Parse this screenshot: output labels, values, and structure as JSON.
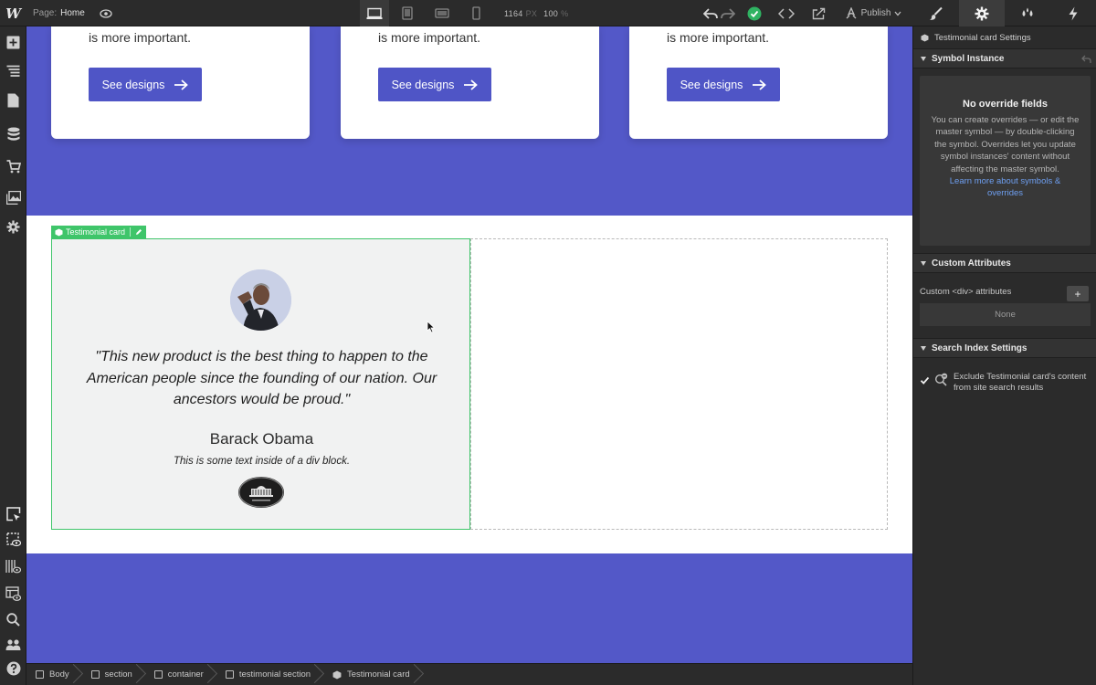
{
  "topbar": {
    "logo": "W",
    "page_label": "Page:",
    "page_name": "Home",
    "width_value": "1164",
    "width_unit": "PX",
    "zoom_value": "100",
    "zoom_unit": "%",
    "publish_label": "Publish"
  },
  "canvas": {
    "cards": [
      {
        "text": "is more important.",
        "button": "See designs"
      },
      {
        "text": "is more important.",
        "button": "See designs"
      },
      {
        "text": "is more important.",
        "button": "See designs"
      }
    ],
    "selected_label": "Testimonial card",
    "testimonial": {
      "quote": "\"This new product is the best thing to happen to the American people since the founding of our nation. Our ancestors would be proud.\"",
      "name": "Barack Obama",
      "subtext": "This is some text inside of a div block."
    },
    "colors": {
      "section_bg": "#5358c8",
      "button_bg": "#4f55c6",
      "selection": "#3fc56a"
    }
  },
  "breadcrumbs": [
    {
      "label": "Body"
    },
    {
      "label": "section"
    },
    {
      "label": "container"
    },
    {
      "label": "testimonial section"
    },
    {
      "label": "Testimonial card"
    }
  ],
  "panel": {
    "title": "Testimonial card Settings",
    "symbol_instance": {
      "heading": "Symbol Instance",
      "title": "No override fields",
      "body": "You can create overrides — or edit the master symbol — by double-clicking the symbol. Overrides let you update symbol instances' content without affecting the master symbol.",
      "link": "Learn more about symbols & overrides"
    },
    "custom_attributes": {
      "heading": "Custom Attributes",
      "label": "Custom <div> attributes",
      "add": "+",
      "empty": "None"
    },
    "search_index": {
      "heading": "Search Index Settings",
      "exclude_label": "Exclude Testimonial card's content from site search results"
    }
  }
}
